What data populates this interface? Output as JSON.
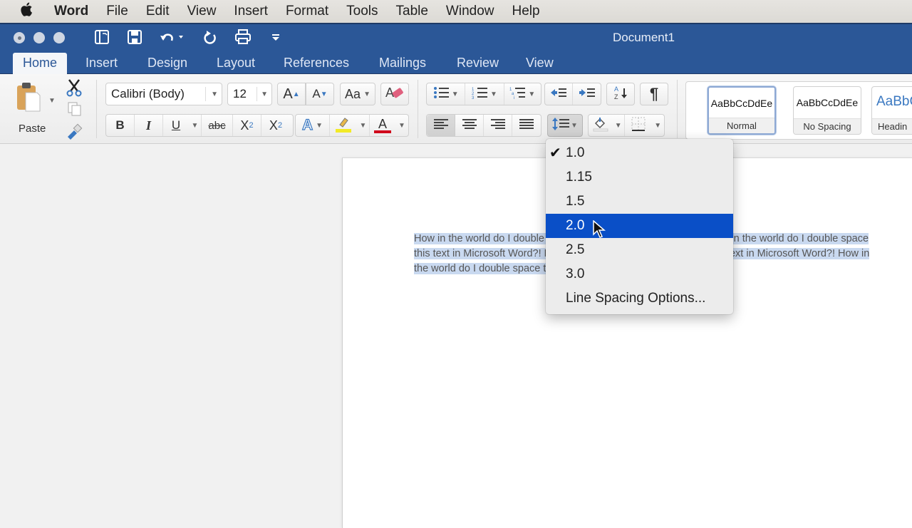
{
  "menubar": {
    "apple_icon": "apple-logo",
    "items": [
      "Word",
      "File",
      "Edit",
      "View",
      "Insert",
      "Format",
      "Tools",
      "Table",
      "Window",
      "Help"
    ]
  },
  "window": {
    "title": "Document1",
    "quick_access": [
      "sidebar-icon",
      "save-icon",
      "undo-icon",
      "redo-icon",
      "print-icon",
      "customize-icon"
    ]
  },
  "tabs": [
    {
      "label": "Home",
      "active": true
    },
    {
      "label": "Insert"
    },
    {
      "label": "Design"
    },
    {
      "label": "Layout"
    },
    {
      "label": "References"
    },
    {
      "label": "Mailings"
    },
    {
      "label": "Review"
    },
    {
      "label": "View"
    }
  ],
  "ribbon": {
    "clipboard": {
      "paste_label": "Paste"
    },
    "font": {
      "font_name": "Calibri (Body)",
      "font_size": "12",
      "bold": "B",
      "italic": "I",
      "underline": "U",
      "strikethrough": "abc",
      "subscript": "X",
      "subscript_mark": "2",
      "superscript": "X",
      "superscript_mark": "2",
      "grow": "A",
      "shrink": "A",
      "change_case": "Aa",
      "text_effects": "A",
      "font_color": "A",
      "highlight_color": "#f2ea27",
      "font_color_value": "#d0021b"
    },
    "paragraph": {
      "show_marks": "¶",
      "sort": "A Z"
    },
    "styles": [
      {
        "sample": "AaBbCcDdEe",
        "name": "Normal",
        "selected": true
      },
      {
        "sample": "AaBbCcDdEe",
        "name": "No Spacing"
      },
      {
        "sample": "AaBbC",
        "name": "Headin"
      }
    ]
  },
  "document": {
    "text": "How in the world do I double space this text in Microsoft Word?! How in the world do I double space this text in Microsoft Word?! How in the world do I double space this text in Microsoft Word?! How in the world do I double space this text in Microsoft Word?!"
  },
  "line_spacing_menu": {
    "items": [
      {
        "label": "1.0",
        "checked": true
      },
      {
        "label": "1.15"
      },
      {
        "label": "1.5"
      },
      {
        "label": "2.0",
        "highlighted": true
      },
      {
        "label": "2.5"
      },
      {
        "label": "3.0"
      },
      {
        "label": "Line Spacing Options..."
      }
    ],
    "highlight_color": "#0a4fc7"
  }
}
